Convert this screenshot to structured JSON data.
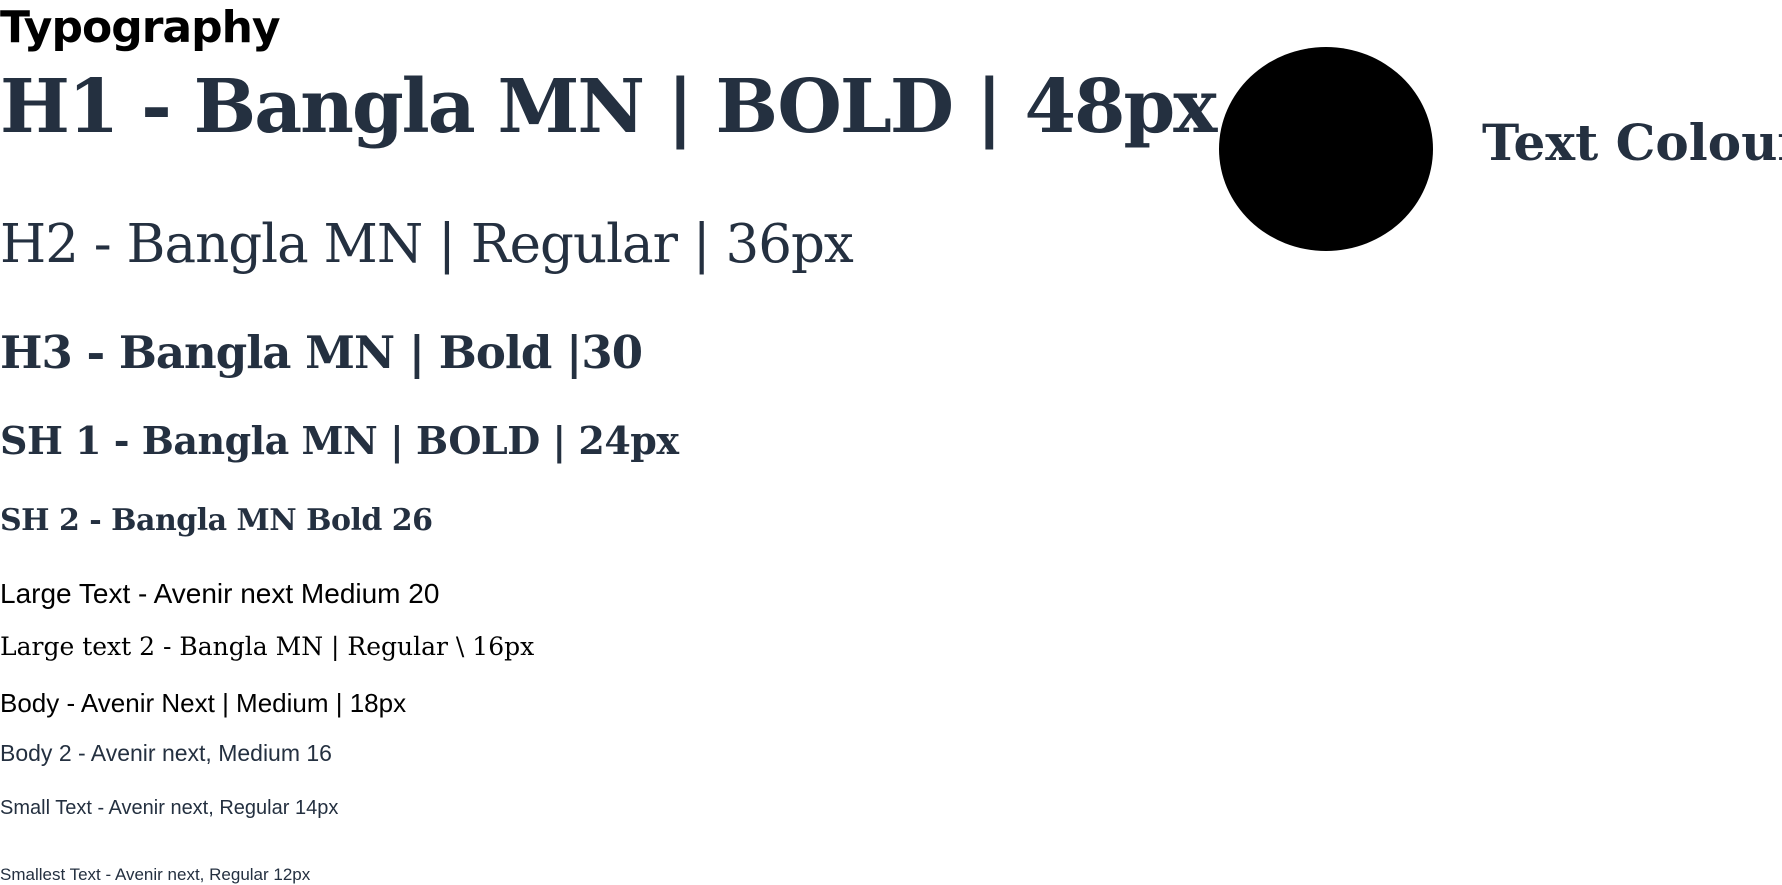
{
  "section_title": "Typography",
  "type_samples": {
    "h1": "H1 - Bangla MN | BOLD | 48px",
    "h2": "H2 - Bangla MN | Regular | 36px",
    "h3": "H3 - Bangla MN | Bold  |30",
    "sh1": "SH 1 - Bangla MN | BOLD | 24px",
    "sh2": "SH 2 -  Bangla MN Bold 26",
    "large_text": "Large Text - Avenir next Medium 20",
    "large_text_2": "Large text 2 - Bangla MN | Regular \\ 16px",
    "body": "Body - Avenir Next | Medium | 18px",
    "body_2": "Body 2 - Avenir next, Medium 16",
    "small_text": "Small Text - Avenir next, Regular 14px",
    "smallest_text": "Smallest Text - Avenir next, Regular 12px"
  },
  "text_colour": {
    "label": "Text Colour",
    "swatch_color": "#000000"
  },
  "colors": {
    "heading_text": "#243040",
    "black": "#000000",
    "background": "#ffffff"
  }
}
